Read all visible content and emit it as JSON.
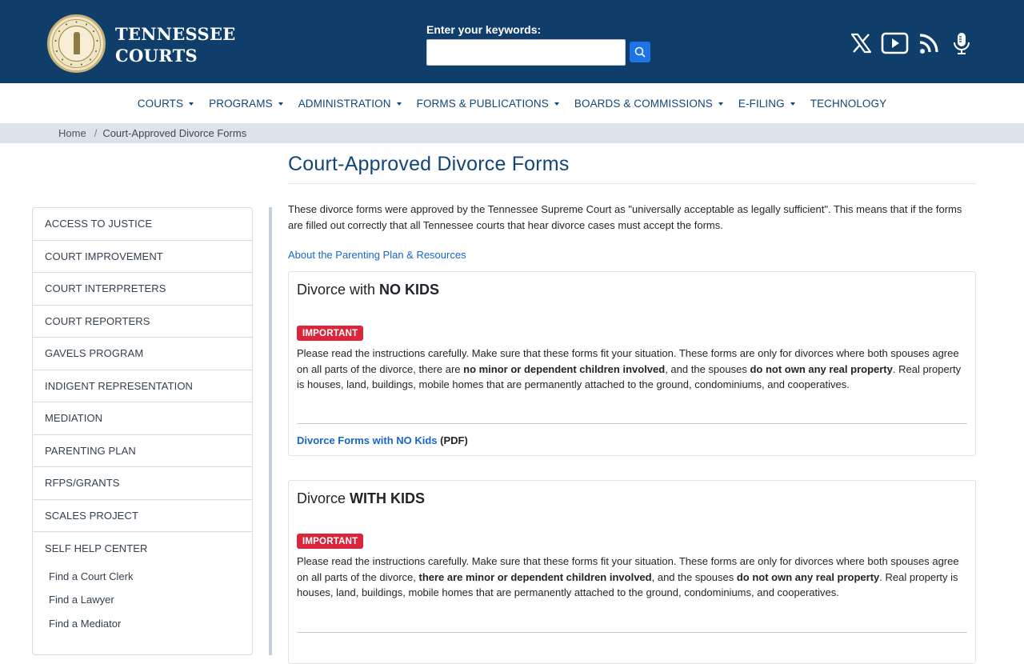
{
  "header": {
    "brand_line1": "TENNESSEE",
    "brand_line2": "COURTS",
    "search_label": "Enter your keywords:",
    "search_value": "",
    "search_placeholder": "",
    "social_icons": [
      "x-icon",
      "youtube-icon",
      "rss-icon",
      "podcast-icon"
    ]
  },
  "nav": {
    "items": [
      {
        "label": "COURTS",
        "dropdown": true
      },
      {
        "label": "PROGRAMS",
        "dropdown": true
      },
      {
        "label": "ADMINISTRATION",
        "dropdown": true
      },
      {
        "label": "FORMS & PUBLICATIONS",
        "dropdown": true
      },
      {
        "label": "BOARDS & COMMISSIONS",
        "dropdown": true
      },
      {
        "label": "E-FILING",
        "dropdown": true
      },
      {
        "label": "TECHNOLOGY",
        "dropdown": false
      }
    ]
  },
  "breadcrumb": {
    "home": "Home",
    "separator": "/",
    "current": "Court-Approved Divorce Forms"
  },
  "page": {
    "title": "Court-Approved Divorce Forms",
    "intro": "These divorce forms were approved by the Tennessee Supreme Court as \"universally acceptable as legally sufficient\". This means that if the forms are filled out correctly that all Tennessee courts that hear divorce cases must accept the forms.",
    "about_link": "About the Parenting Plan & Resources"
  },
  "sidebar": {
    "items": [
      "ACCESS TO JUSTICE",
      "COURT IMPROVEMENT",
      "COURT INTERPRETERS",
      "COURT REPORTERS",
      "GAVELS PROGRAM",
      "INDIGENT REPRESENTATION",
      "MEDIATION",
      "PARENTING PLAN",
      "RFPS/GRANTS",
      "SCALES PROJECT",
      "SELF HELP CENTER"
    ],
    "sub_items": [
      "Find a Court Clerk",
      "Find a Lawyer",
      "Find a Mediator"
    ]
  },
  "cards": {
    "no_kids": {
      "title_prefix": "Divorce with ",
      "title_bold": "NO KIDS",
      "badge": "IMPORTANT",
      "text_1": "Please read the instructions carefully. Make sure that these forms fit your situation. These forms are only for divorces where both spouses agree on all parts of the divorce, there are ",
      "bold_1": "no minor or dependent children involved",
      "text_2": ", and the spouses ",
      "bold_2": "do not own any real property",
      "text_3": ".  Real property is houses, land, buildings, mobile homes that are permanently attached to the ground, condominiums, and cooperatives.",
      "link": "Divorce Forms with NO Kids",
      "link_suffix": " (PDF)"
    },
    "with_kids": {
      "title_prefix": "Divorce ",
      "title_bold": "WITH KIDS",
      "badge": "IMPORTANT",
      "text_1": "Please read the instructions carefully. Make sure that these forms fit your situation. These forms are only for divorces where both spouses agree on all parts of the divorce, ",
      "bold_1": "there are minor or dependent children involved",
      "text_2": ", and the spouses ",
      "bold_2": "do not own any real property",
      "text_3": ".  Real property is houses, land, buildings, mobile homes that are permanently attached to the ground, condominiums, and cooperatives."
    }
  },
  "colors": {
    "header_bg": "#0f3e6b",
    "nav_text": "#12457a",
    "link": "#1766c8",
    "badge": "#d9263d",
    "search_button": "#1e74e6"
  }
}
